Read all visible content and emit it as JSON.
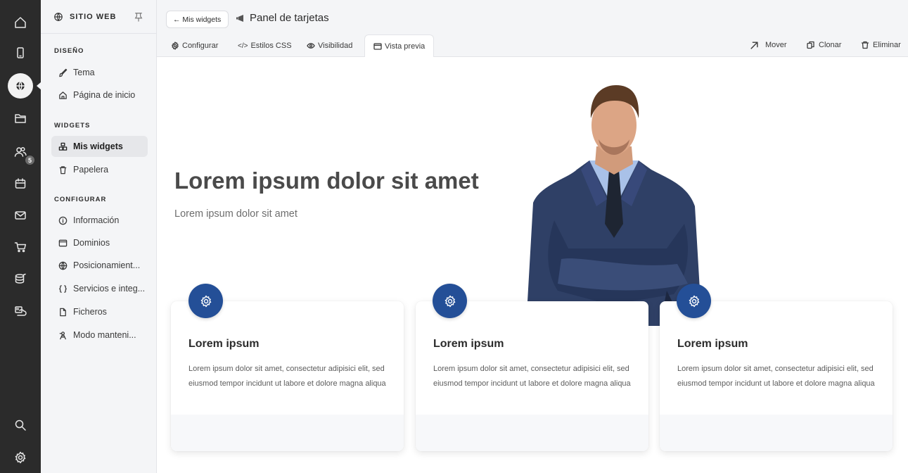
{
  "rail": {
    "items": [
      {
        "name": "home-icon"
      },
      {
        "name": "mobile-icon"
      },
      {
        "name": "globe-icon",
        "active": true
      },
      {
        "name": "folder-icon"
      },
      {
        "name": "users-icon",
        "badge": "5"
      },
      {
        "name": "calendar-icon"
      },
      {
        "name": "mail-icon"
      },
      {
        "name": "cart-icon"
      },
      {
        "name": "database-icon"
      },
      {
        "name": "cloud-icon"
      },
      {
        "name": "search-icon"
      },
      {
        "name": "gear-icon"
      }
    ]
  },
  "sidebar": {
    "header_title": "SITIO WEB",
    "sections": {
      "design": "DISEÑO",
      "widgets": "WIDGETS",
      "configure": "CONFIGURAR"
    },
    "items": {
      "theme": "Tema",
      "home_page": "Página de inicio",
      "my_widgets": "Mis widgets",
      "trash": "Papelera",
      "information": "Información",
      "domains": "Dominios",
      "seo": "Posicionamient...",
      "services": "Servicios e integ...",
      "files": "Ficheros",
      "maintenance": "Modo manteni..."
    }
  },
  "topbar": {
    "back_label": "← Mis widgets",
    "panel_title": "Panel de tarjetas",
    "tabs": {
      "configure": "Configurar",
      "css": "Estilos CSS",
      "visibility": "Visibilidad",
      "preview": "Vista previa"
    },
    "actions": {
      "move": "Mover",
      "clone": "Clonar",
      "delete": "Eliminar"
    }
  },
  "preview": {
    "hero_title": "Lorem ipsum dolor sit amet",
    "hero_subtitle": "Lorem ipsum dolor sit amet",
    "accent_color": "#244f97",
    "cards": [
      {
        "title": "Lorem ipsum",
        "text": "Lorem ipsum dolor sit amet, consectetur adipisici elit, sed eiusmod tempor incidunt ut labore et dolore magna aliqua"
      },
      {
        "title": "Lorem ipsum",
        "text": "Lorem ipsum dolor sit amet, consectetur adipisici elit, sed eiusmod tempor incidunt ut labore et dolore magna aliqua"
      },
      {
        "title": "Lorem ipsum",
        "text": "Lorem ipsum dolor sit amet, consectetur adipisici elit, sed eiusmod tempor incidunt ut labore et dolore magna aliqua"
      }
    ]
  }
}
